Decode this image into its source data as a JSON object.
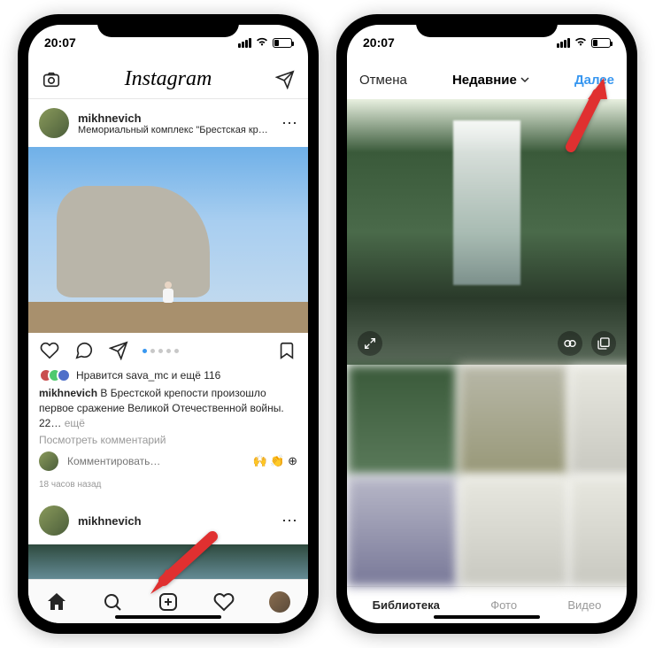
{
  "status": {
    "time": "20:07"
  },
  "feed": {
    "logo": "Instagram",
    "post1": {
      "username": "mikhnevich",
      "location": "Мемориальный комплекс \"Брестская крепость-ге…",
      "likes_text": "Нравится sava_mc и ещё 116",
      "caption_user": "mikhnevich",
      "caption_text": " В Брестской крепости произошло первое сражение Великой Отечественной войны. 22… ",
      "caption_more": "ещё",
      "view_comments": "Посмотреть комментарий",
      "comment_placeholder": "Комментировать…",
      "timestamp": "18 часов назад"
    },
    "post2": {
      "username": "mikhnevich"
    }
  },
  "picker": {
    "cancel": "Отмена",
    "title": "Недавние",
    "next": "Далее",
    "tabs": {
      "library": "Библиотека",
      "photo": "Фото",
      "video": "Видео"
    }
  }
}
